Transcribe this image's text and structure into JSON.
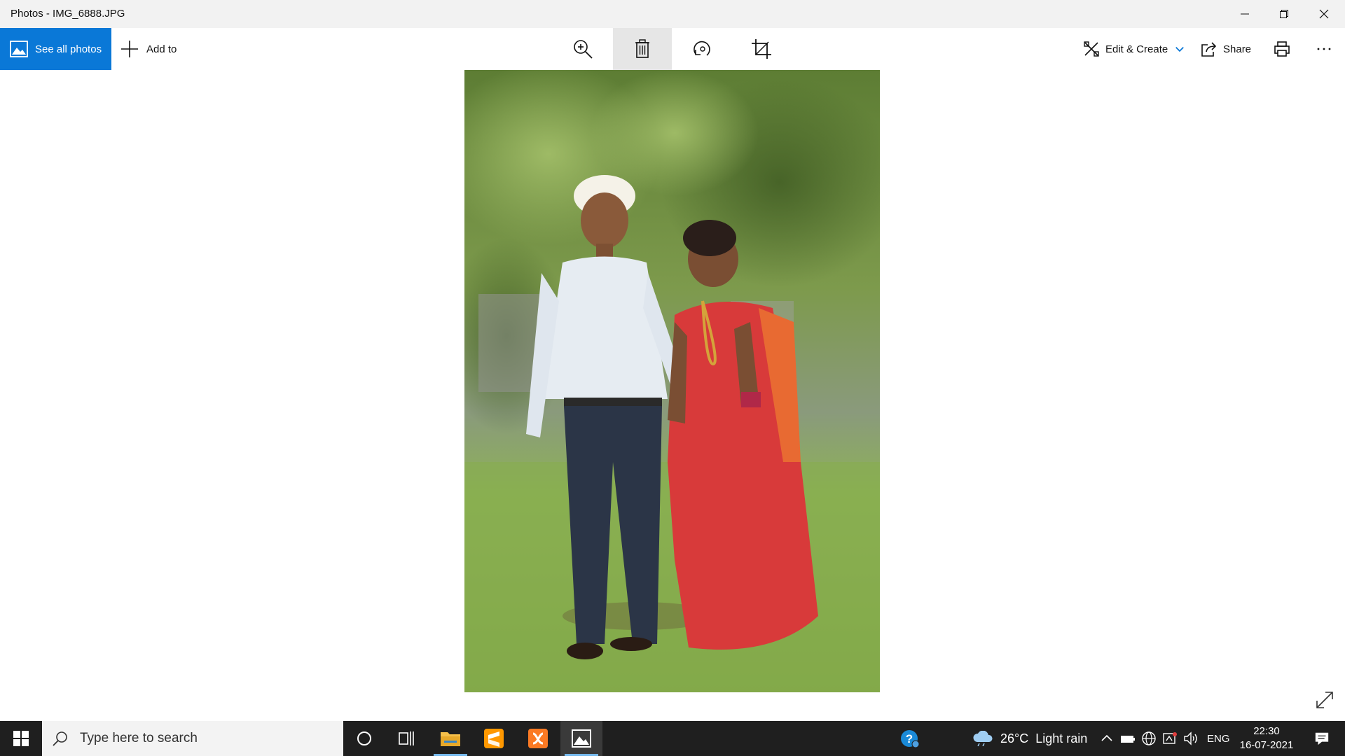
{
  "window": {
    "title": "Photos - IMG_6888.JPG"
  },
  "toolbar": {
    "see_all_label": "See all photos",
    "add_to_label": "Add to",
    "edit_create_label": "Edit & Create",
    "share_label": "Share"
  },
  "taskbar": {
    "search_placeholder": "Type here to search",
    "weather": "26°C  Light rain",
    "language": "ENG",
    "time": "22:30",
    "date": "16-07-2021"
  },
  "colors": {
    "accent": "#0a78d7",
    "taskbar": "#1f1f1f"
  }
}
